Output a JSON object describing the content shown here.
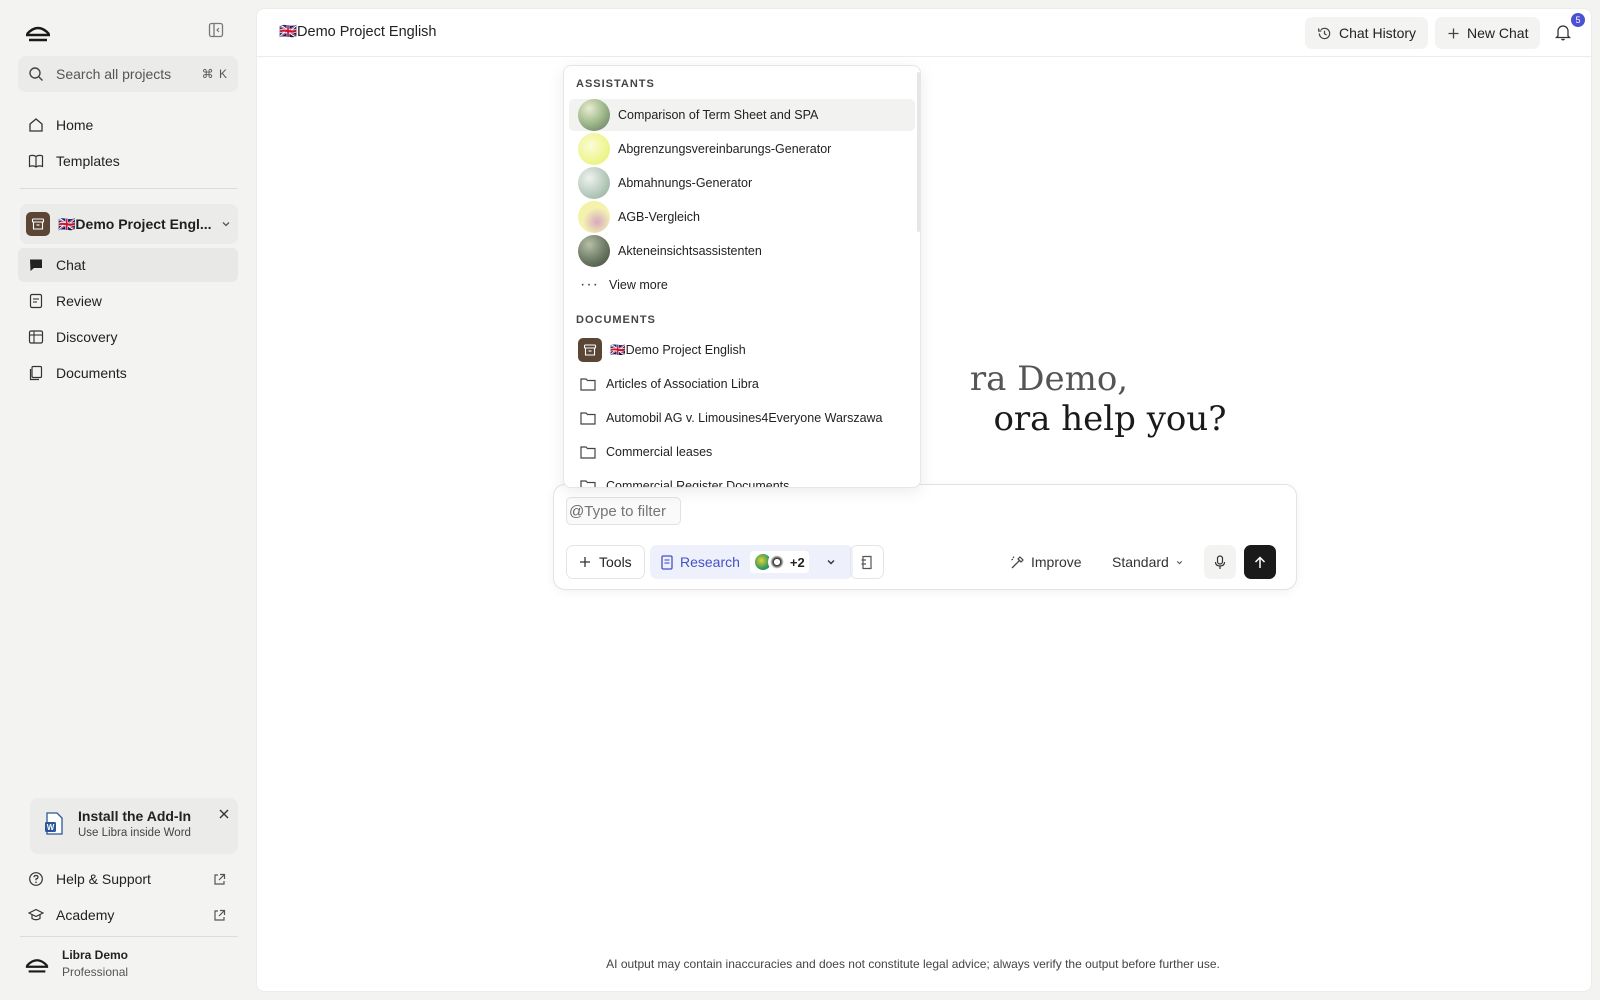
{
  "sidebar": {
    "search_placeholder": "Search all projects",
    "search_shortcut": "⌘ K",
    "nav_top": [
      {
        "label": "Home"
      },
      {
        "label": "Templates"
      }
    ],
    "project": {
      "label": "🇬🇧Demo Project Engl..."
    },
    "nav_project": [
      {
        "label": "Chat"
      },
      {
        "label": "Review"
      },
      {
        "label": "Discovery"
      },
      {
        "label": "Documents"
      }
    ],
    "addin": {
      "title": "Install the Add-In",
      "subtitle": "Use Libra inside Word"
    },
    "footer_links": [
      {
        "label": "Help & Support"
      },
      {
        "label": "Academy"
      }
    ],
    "user": {
      "name": "Libra Demo",
      "plan": "Professional"
    }
  },
  "header": {
    "breadcrumb": "🇬🇧Demo Project English",
    "chat_history": "Chat History",
    "new_chat": "New Chat",
    "notification_count": "5"
  },
  "greeting": {
    "line1": "ra Demo,",
    "line2": "ora help you?"
  },
  "composer": {
    "at_symbol": "@",
    "input_placeholder": "Type to filter",
    "tools": "Tools",
    "research": "Research",
    "research_extra": "+2",
    "improve": "Improve",
    "mode": "Standard"
  },
  "dropdown": {
    "assistants_heading": "ASSISTANTS",
    "assistants": [
      {
        "label": "Comparison of Term Sheet and SPA"
      },
      {
        "label": "Abgrenzungsvereinbarungs-Generator"
      },
      {
        "label": "Abmahnungs-Generator"
      },
      {
        "label": "AGB-Vergleich"
      },
      {
        "label": "Akteneinsichtsassistenten"
      }
    ],
    "view_more": "View more",
    "documents_heading": "DOCUMENTS",
    "documents": [
      {
        "label": "🇬🇧Demo Project English"
      },
      {
        "label": "Articles of Association Libra"
      },
      {
        "label": "Automobil AG v. Limousines4Everyone Warszawa"
      },
      {
        "label": "Commercial leases"
      },
      {
        "label": "Commercial Register Documents"
      }
    ]
  },
  "disclaimer": "AI output may contain inaccuracies and does not constitute legal advice; always verify the output before further use.",
  "colors": {
    "accent": "#4451c7",
    "badge": "#4a52d1",
    "project_icon": "#5b4636"
  }
}
